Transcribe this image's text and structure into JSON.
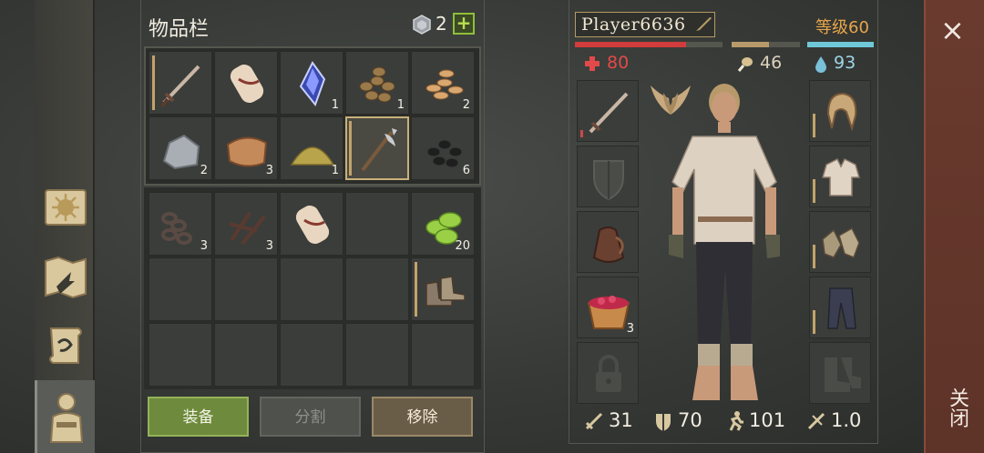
{
  "inventory": {
    "title": "物品栏",
    "gem_count": "2",
    "plus_label": "+",
    "top_grid": [
      {
        "item": "sword",
        "count": "",
        "durability": true
      },
      {
        "item": "rope-bundle",
        "count": "",
        "durability": false
      },
      {
        "item": "crystal",
        "count": "1",
        "durability": false
      },
      {
        "item": "nuts",
        "count": "1",
        "durability": false
      },
      {
        "item": "seeds",
        "count": "2",
        "durability": false
      },
      {
        "item": "stone",
        "count": "2",
        "durability": false
      },
      {
        "item": "leather",
        "count": "3",
        "durability": false
      },
      {
        "item": "sulfur-powder",
        "count": "1",
        "durability": false
      },
      {
        "item": "halberd",
        "count": "",
        "durability": true
      },
      {
        "item": "coal",
        "count": "6",
        "durability": false
      }
    ],
    "bottom_grid": [
      {
        "item": "chain",
        "count": "3"
      },
      {
        "item": "nails",
        "count": "3"
      },
      {
        "item": "rope-bundle",
        "count": ""
      },
      {
        "item": "",
        "count": ""
      },
      {
        "item": "green-plants",
        "count": "20"
      },
      {
        "item": "",
        "count": ""
      },
      {
        "item": "",
        "count": ""
      },
      {
        "item": "",
        "count": ""
      },
      {
        "item": "",
        "count": ""
      },
      {
        "item": "boots",
        "count": ""
      },
      {
        "item": "",
        "count": ""
      },
      {
        "item": "",
        "count": ""
      },
      {
        "item": "",
        "count": ""
      },
      {
        "item": "",
        "count": ""
      },
      {
        "item": "",
        "count": ""
      }
    ],
    "actions": {
      "equip": "装备",
      "split": "分割",
      "remove": "移除"
    }
  },
  "character": {
    "name": "Player6636",
    "level": "等级60",
    "health": "80",
    "food": "46",
    "water": "93",
    "bars": {
      "health": 0.75,
      "food": 0.55,
      "water": 1.0,
      "health_color": "#d13c3c",
      "food_color": "#b89a6a",
      "water_color": "#6fc8d8"
    },
    "left_slots": [
      "sword",
      "shield",
      "bag",
      "berries",
      "locked-slot"
    ],
    "left_slot_counts": [
      "",
      "",
      "",
      "3",
      ""
    ],
    "right_slots": [
      "hood",
      "shirt",
      "gloves",
      "pants",
      "boots"
    ],
    "stats": {
      "attack": "31",
      "defense": "70",
      "speed": "101",
      "multiplier": "1.0"
    }
  },
  "close": {
    "symbol": "×",
    "label": "关闭"
  },
  "colors": {
    "accent_level": "#e8a64a",
    "equip_button": "#6e8b3d",
    "close_panel": "#6a3a2e"
  }
}
